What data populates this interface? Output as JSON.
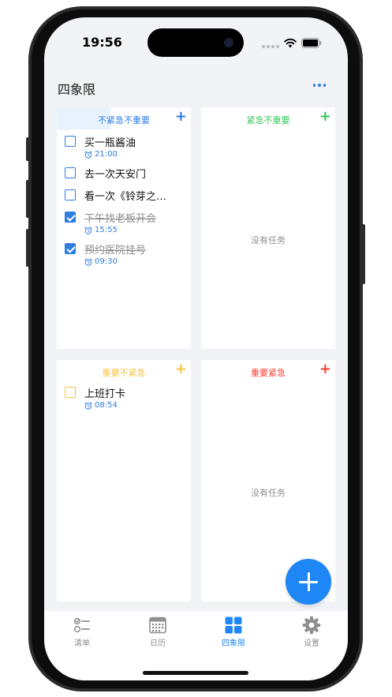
{
  "status_bar": {
    "time": "19:56"
  },
  "header": {
    "title": "四象限"
  },
  "quadrants": {
    "not_urgent_not_important": {
      "title": "不紧急不重要",
      "color": "#2f7de1",
      "tasks": [
        {
          "title": "买一瓶酱油",
          "time": "21:00",
          "done": false
        },
        {
          "title": "去一次天安门",
          "time": "",
          "done": false
        },
        {
          "title": "看一次《铃芽之…",
          "time": "",
          "done": false
        },
        {
          "title": "下午找老板开会",
          "time": "15:55",
          "done": true
        },
        {
          "title": "预约医院挂号",
          "time": "09:30",
          "done": true
        }
      ]
    },
    "urgent_not_important": {
      "title": "紧急不重要",
      "color": "#34c759",
      "empty_text": "没有任务"
    },
    "important_not_urgent": {
      "title": "重要不紧急",
      "color": "#f6c343",
      "tasks": [
        {
          "title": "上班打卡",
          "time": "08:54",
          "done": false
        }
      ]
    },
    "important_urgent": {
      "title": "重要紧急",
      "color": "#ff3b30",
      "empty_text": "没有任务"
    }
  },
  "tabs": [
    {
      "label": "清单",
      "icon": "checklist-icon",
      "active": false
    },
    {
      "label": "日历",
      "icon": "calendar-icon",
      "active": false
    },
    {
      "label": "四象限",
      "icon": "grid-icon",
      "active": true
    },
    {
      "label": "设置",
      "icon": "gear-icon",
      "active": false
    }
  ]
}
